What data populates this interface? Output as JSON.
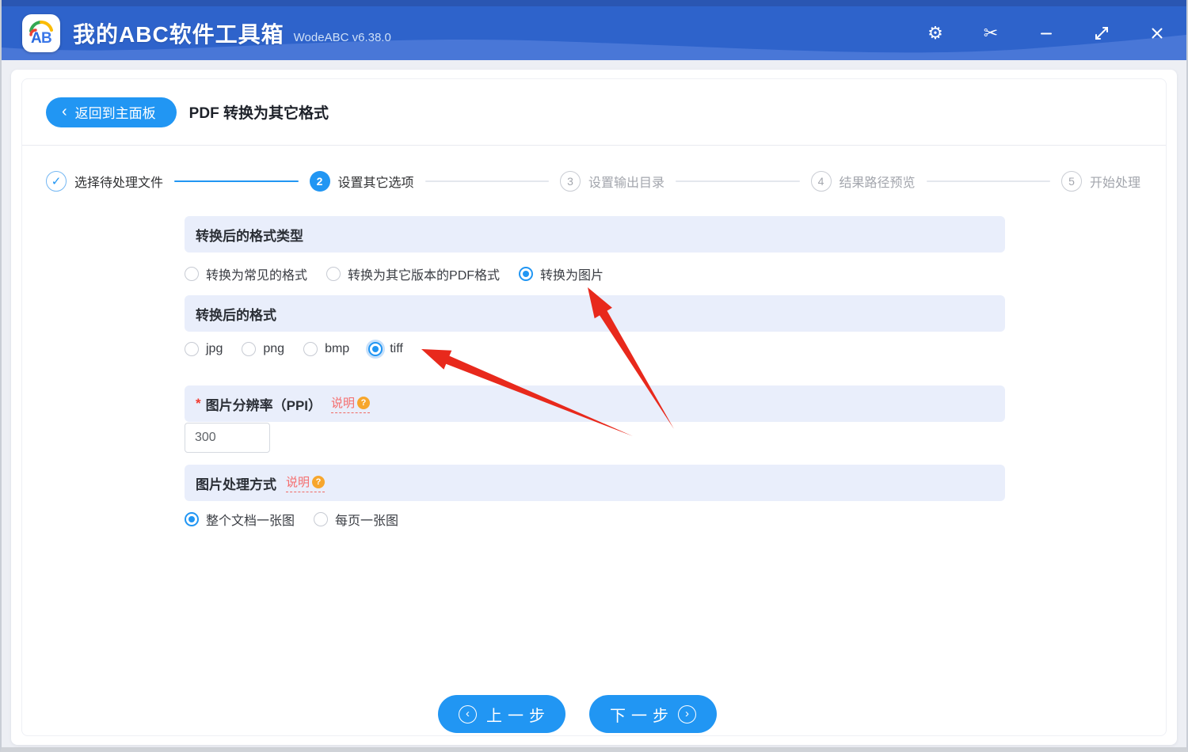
{
  "titlebar": {
    "app_title": "我的ABC软件工具箱",
    "version": "WodeABC v6.38.0",
    "logo_letters": "AB",
    "icons": [
      "settings-gear",
      "scissors-screenshot",
      "minimize",
      "maximize",
      "close"
    ]
  },
  "header": {
    "back_button_label": "返回到主面板",
    "page_title": "PDF 转换为其它格式"
  },
  "steps": [
    {
      "num": "1",
      "label": "选择待处理文件",
      "state": "done"
    },
    {
      "num": "2",
      "label": "设置其它选项",
      "state": "active"
    },
    {
      "num": "3",
      "label": "设置输出目录",
      "state": "pending"
    },
    {
      "num": "4",
      "label": "结果路径预览",
      "state": "pending"
    },
    {
      "num": "5",
      "label": "开始处理",
      "state": "pending"
    }
  ],
  "sections": {
    "format_type": {
      "title": "转换后的格式类型",
      "options": [
        {
          "label": "转换为常见的格式",
          "checked": false
        },
        {
          "label": "转换为其它版本的PDF格式",
          "checked": false
        },
        {
          "label": "转换为图片",
          "checked": true
        }
      ]
    },
    "image_format": {
      "title": "转换后的格式",
      "options": [
        {
          "label": "jpg",
          "checked": false
        },
        {
          "label": "png",
          "checked": false
        },
        {
          "label": "bmp",
          "checked": false
        },
        {
          "label": "tiff",
          "checked": true
        }
      ]
    },
    "resolution": {
      "required_mark": "*",
      "title": "图片分辨率（PPI）",
      "help_link": "说明",
      "value": "300"
    },
    "processing": {
      "title": "图片处理方式",
      "help_link": "说明",
      "options": [
        {
          "label": "整个文档一张图",
          "checked": true
        },
        {
          "label": "每页一张图",
          "checked": false
        }
      ]
    }
  },
  "footer": {
    "prev_label": "上一步",
    "next_label": "下一步"
  },
  "colors": {
    "primary_blue": "#2196f3",
    "titlebar_blue": "#2e63cb",
    "section_bar_bg": "#e9eefb",
    "annotation_red": "#e8291c",
    "help_red": "#f56c6c",
    "help_badge_orange": "#f7a62c"
  }
}
